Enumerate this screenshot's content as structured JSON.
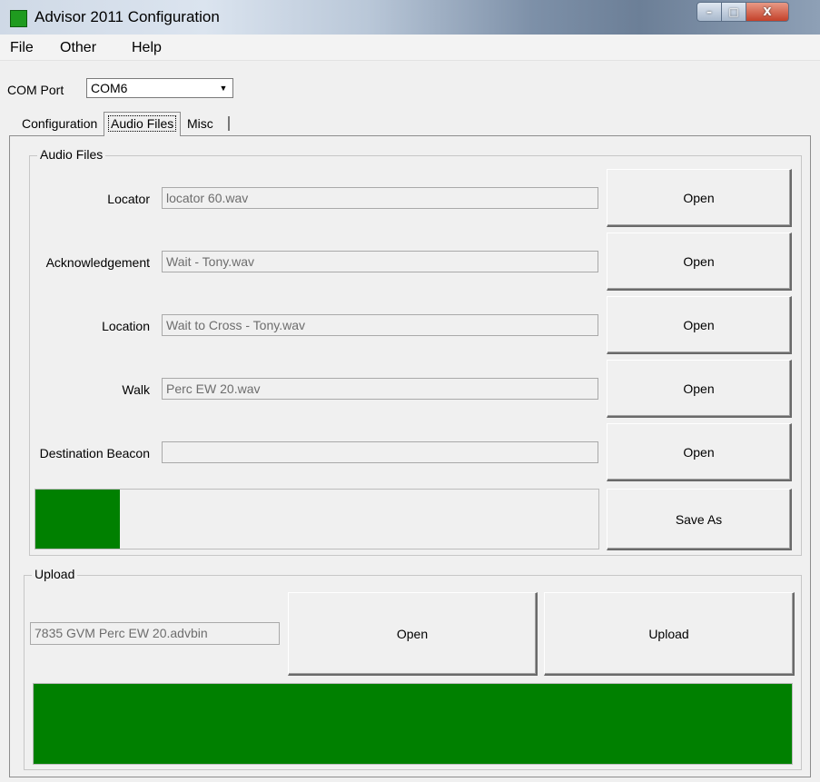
{
  "window": {
    "title": "Advisor 2011 Configuration",
    "controls": {
      "minimize": "–",
      "maximize": "□",
      "close": "X"
    }
  },
  "menu": [
    "File",
    "Other",
    "Help"
  ],
  "com_port": {
    "label": "COM Port",
    "value": "COM6"
  },
  "tabs": [
    {
      "label": "Configuration",
      "selected": false
    },
    {
      "label": "Audio Files",
      "selected": true
    },
    {
      "label": "Misc",
      "selected": false
    }
  ],
  "audio_files": {
    "legend": "Audio Files",
    "rows": [
      {
        "label": "Locator",
        "value": "locator 60.wav",
        "button": "Open"
      },
      {
        "label": "Acknowledgement",
        "value": "Wait - Tony.wav",
        "button": "Open"
      },
      {
        "label": "Location",
        "value": "Wait to Cross - Tony.wav",
        "button": "Open"
      },
      {
        "label": "Walk",
        "value": "Perc EW 20.wav",
        "button": "Open"
      },
      {
        "label": "Destination Beacon",
        "value": "",
        "button": "Open"
      }
    ],
    "progress": 0.15,
    "progress_color": "#008000",
    "save_as": "Save As"
  },
  "upload": {
    "legend": "Upload",
    "file": "7835 GVM Perc EW 20.advbin",
    "open_button": "Open",
    "upload_button": "Upload",
    "progress": 1.0,
    "progress_color": "#008000"
  },
  "icons": [
    "app-icon",
    "minimize-icon",
    "maximize-icon",
    "close-icon",
    "chevron-down-icon"
  ]
}
